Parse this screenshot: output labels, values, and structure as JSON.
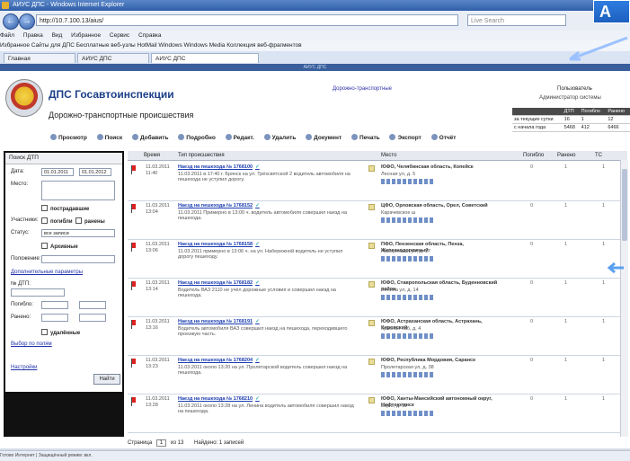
{
  "browser": {
    "title": "АИУС ДПС - Windows Internet Explorer",
    "url": "http://10.7.100.13/aius/",
    "search_placeholder": "Live Search",
    "back_icon": "back-icon",
    "forward_icon": "forward-icon",
    "menu": [
      "Файл",
      "Правка",
      "Вид",
      "Избранное",
      "Сервис",
      "Справка"
    ],
    "favorites": "Избранное   Сайты для ДПС  Бесплатные веб-узлы  HotMail  Windows  Windows Media  Коллекция веб-фрагментов",
    "tabs": [
      "Главная",
      "АИУС ДПС",
      "АИУС ДПС"
    ],
    "banner": "АИУС ДПС"
  },
  "header": {
    "app_title": "ДПС Госавтоинспекции",
    "page_title": "Дорожно-транспортные происшествия",
    "link": "Дорожно-транспортные",
    "user": "Пользователь",
    "user_sub": "Администратор системы"
  },
  "toolbar": {
    "items": [
      "Просмотр",
      "Поиск",
      "Добавить",
      "Подробно",
      "Редакт.",
      "Удалить",
      "Документ",
      "Печать",
      "Экспорт",
      "Отчёт"
    ]
  },
  "stats": {
    "headers": [
      "",
      "ДТП",
      "Погибло",
      "Ранено"
    ],
    "rows": [
      [
        "за текущие сутки",
        "16",
        "1",
        "12"
      ],
      [
        "с начала года",
        "5468",
        "412",
        "6466"
      ]
    ]
  },
  "filter": {
    "title": "Поиск ДТП",
    "date_label": "Дата:",
    "date_from": "01.01.2011",
    "date_to": "01.01.2012",
    "place_label": "Место:",
    "with_victims": "пострадавшие",
    "participants_label": "Участники:",
    "died": "погибли",
    "injured": "ранены",
    "status_label": "Статус:",
    "status_value": "все записи",
    "archived": "Архивные",
    "location_label": "Положение:",
    "extra_params": "Дополнительные параметры",
    "dtp_number": "№ ДТП:",
    "killed_label": "Погибло:",
    "wounded_label": "Ранено:",
    "deleted": "удалённые",
    "save_search": "Выбор по полям",
    "settings_link": "Настройки",
    "find_button": "Найти"
  },
  "grid": {
    "columns": [
      "",
      "Время",
      "Тип происшествия",
      "Место",
      "Погибло",
      "Ранено",
      "ТС"
    ],
    "rows": [
      {
        "date": "11.03.2011",
        "time": "11:40",
        "type": "Наезд на пешехода",
        "id": "№ 1768100",
        "desc": "11.03.2011 в 17:40 г. Брянск на ул. Трёхсвятской 2 водитель автомобиля на пешехода не уступил дорогу.",
        "place": "ЮФО, Челябинская область, Копейск",
        "addr": "Лесная ул, д. 5",
        "killed": "0",
        "injured": "1",
        "ts": "1"
      },
      {
        "date": "11.03.2011",
        "time": "13:04",
        "type": "Наезд на пешехода",
        "id": "№ 1768152",
        "desc": "11.03.2011 Примерно в 13:00 ч. водитель автомобиля совершил наезд на пешехода.",
        "place": "ЦФО, Орловская область, Орел, Советский",
        "addr": "Карачевское ш",
        "killed": "0",
        "injured": "1",
        "ts": "1"
      },
      {
        "date": "11.03.2011",
        "time": "13:06",
        "type": "Наезд на пешехода",
        "id": "№ 1768158",
        "desc": "11.03.2011 примерно в 13:06 ч. на ул. Набережной водитель не уступил дорогу пешеходу.",
        "place": "ПФО, Пензенская область, Пенза, Железнодорожный",
        "addr": "Набережная ул, д. 17",
        "killed": "0",
        "injured": "1",
        "ts": "1"
      },
      {
        "date": "11.03.2011",
        "time": "13:14",
        "type": "Наезд на пешехода",
        "id": "№ 1768182",
        "desc": "Водитель ВАЗ 2110 не учёл дорожные условия и совершил наезд на пешехода.",
        "place": "ЮФО, Ставропольская область, Буденновский район",
        "addr": "Ленина ул, д. 14",
        "killed": "0",
        "injured": "1",
        "ts": "1"
      },
      {
        "date": "11.03.2011",
        "time": "13:16",
        "type": "Наезд на пешехода",
        "id": "№ 1768191",
        "desc": "Водитель автомобиля ВАЗ совершил наезд на пешехода, переходившего проезжую часть.",
        "place": "ЮФО, Астраханская область, Астрахань, Кировский",
        "addr": "Красная наб, д. 4",
        "killed": "0",
        "injured": "1",
        "ts": "1"
      },
      {
        "date": "11.03.2011",
        "time": "13:23",
        "type": "Наезд на пешехода",
        "id": "№ 1768204",
        "desc": "11.03.2011 около 13:20 на ул. Пролетарской водитель совершил наезд на пешехода.",
        "place": "ЮФО, Республика Мордовия, Саранск",
        "addr": "Пролетарская ул, д. 38",
        "killed": "0",
        "injured": "1",
        "ts": "1"
      },
      {
        "date": "11.03.2011",
        "time": "13:28",
        "type": "Наезд на пешехода",
        "id": "№ 1768210",
        "desc": "11.03.2011 около 13:28 на ул. Ленина водитель автомобиля совершил наезд на пешехода.",
        "place": "ЮФО, Ханты-Мансийский автономный округ, Нефтеюганск",
        "addr": "мкр 3, д. 11",
        "killed": "0",
        "injured": "1",
        "ts": "1"
      }
    ]
  },
  "pager": {
    "label": "Страница",
    "page": "1",
    "of": "из 13",
    "shown": "Найдено: 1 записей"
  },
  "status": "Готово   Интернет | Защищённый режим: вкл.",
  "callout": {
    "label": "А"
  },
  "colors": {
    "accent": "#1c3f88",
    "flag": "#dd2222"
  }
}
